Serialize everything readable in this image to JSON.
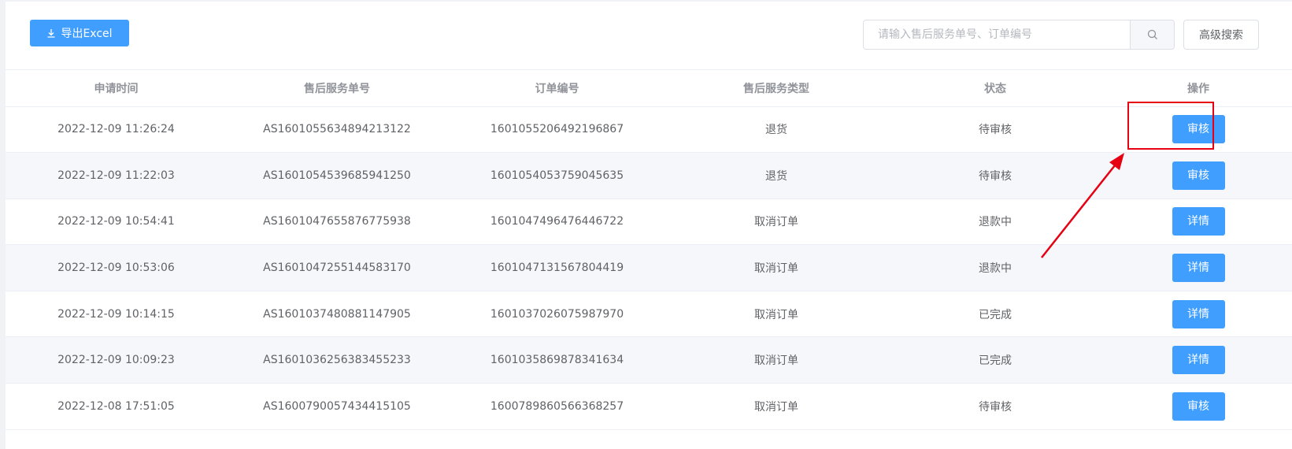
{
  "toolbar": {
    "export_label": "导出Excel",
    "export_icon": "download-icon",
    "search_placeholder": "请输入售后服务单号、订单编号",
    "search_value": "",
    "search_icon": "search-icon",
    "advanced_search_label": "高级搜索"
  },
  "table": {
    "headers": [
      "申请时间",
      "售后服务单号",
      "订单编号",
      "售后服务类型",
      "状态",
      "操作"
    ],
    "rows": [
      {
        "time": "2022-12-09 11:26:24",
        "service_no": "AS1601055634894213122",
        "order_no": "1601055206492196867",
        "type": "退货",
        "status": "待审核",
        "action": "审核"
      },
      {
        "time": "2022-12-09 11:22:03",
        "service_no": "AS1601054539685941250",
        "order_no": "1601054053759045635",
        "type": "退货",
        "status": "待审核",
        "action": "审核"
      },
      {
        "time": "2022-12-09 10:54:41",
        "service_no": "AS1601047655876775938",
        "order_no": "1601047496476446722",
        "type": "取消订单",
        "status": "退款中",
        "action": "详情"
      },
      {
        "time": "2022-12-09 10:53:06",
        "service_no": "AS1601047255144583170",
        "order_no": "1601047131567804419",
        "type": "取消订单",
        "status": "退款中",
        "action": "详情"
      },
      {
        "time": "2022-12-09 10:14:15",
        "service_no": "AS1601037480881147905",
        "order_no": "1601037026075987970",
        "type": "取消订单",
        "status": "已完成",
        "action": "详情"
      },
      {
        "time": "2022-12-09 10:09:23",
        "service_no": "AS1601036256383455233",
        "order_no": "1601035869878341634",
        "type": "取消订单",
        "status": "已完成",
        "action": "详情"
      },
      {
        "time": "2022-12-08 17:51:05",
        "service_no": "AS1600790057434415105",
        "order_no": "1600789860566368257",
        "type": "取消订单",
        "status": "待审核",
        "action": "审核"
      }
    ]
  },
  "colors": {
    "primary": "#409eff",
    "annotation": "#e60012"
  }
}
